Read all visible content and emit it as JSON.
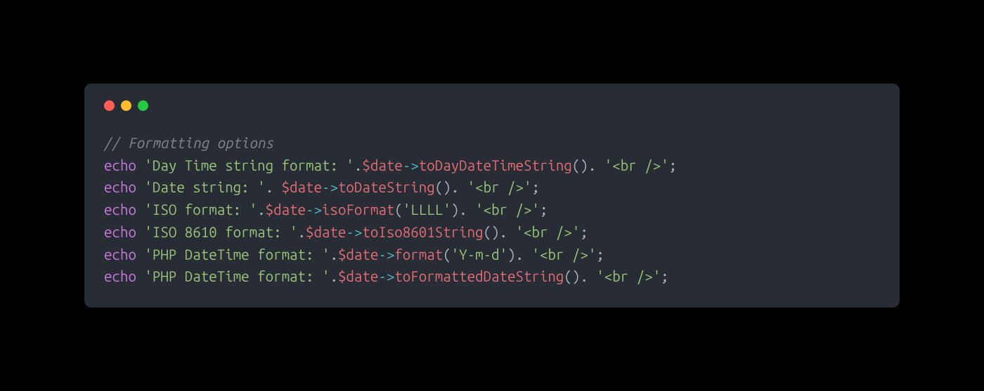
{
  "window": {
    "buttons": [
      "close",
      "minimize",
      "zoom"
    ]
  },
  "code": {
    "lines": [
      [
        {
          "cls": "tok-comment",
          "text": "// Formatting options"
        }
      ],
      [
        {
          "cls": "tok-keyword",
          "text": "echo"
        },
        {
          "cls": "tok-punct",
          "text": " "
        },
        {
          "cls": "tok-string",
          "text": "'Day Time string format: '"
        },
        {
          "cls": "tok-punct",
          "text": "."
        },
        {
          "cls": "tok-variable",
          "text": "$date"
        },
        {
          "cls": "tok-operator",
          "text": "->"
        },
        {
          "cls": "tok-method",
          "text": "toDayDateTimeString"
        },
        {
          "cls": "tok-punct",
          "text": "(). "
        },
        {
          "cls": "tok-string",
          "text": "'<br />'"
        },
        {
          "cls": "tok-punct",
          "text": ";"
        }
      ],
      [
        {
          "cls": "tok-keyword",
          "text": "echo"
        },
        {
          "cls": "tok-punct",
          "text": " "
        },
        {
          "cls": "tok-string",
          "text": "'Date string: '"
        },
        {
          "cls": "tok-punct",
          "text": ". "
        },
        {
          "cls": "tok-variable",
          "text": "$date"
        },
        {
          "cls": "tok-operator",
          "text": "->"
        },
        {
          "cls": "tok-method",
          "text": "toDateString"
        },
        {
          "cls": "tok-punct",
          "text": "(). "
        },
        {
          "cls": "tok-string",
          "text": "'<br />'"
        },
        {
          "cls": "tok-punct",
          "text": ";"
        }
      ],
      [
        {
          "cls": "tok-keyword",
          "text": "echo"
        },
        {
          "cls": "tok-punct",
          "text": " "
        },
        {
          "cls": "tok-string",
          "text": "'ISO format: '"
        },
        {
          "cls": "tok-punct",
          "text": "."
        },
        {
          "cls": "tok-variable",
          "text": "$date"
        },
        {
          "cls": "tok-operator",
          "text": "->"
        },
        {
          "cls": "tok-method",
          "text": "isoFormat"
        },
        {
          "cls": "tok-punct",
          "text": "("
        },
        {
          "cls": "tok-string",
          "text": "'LLLL'"
        },
        {
          "cls": "tok-punct",
          "text": "). "
        },
        {
          "cls": "tok-string",
          "text": "'<br />'"
        },
        {
          "cls": "tok-punct",
          "text": ";"
        }
      ],
      [
        {
          "cls": "tok-keyword",
          "text": "echo"
        },
        {
          "cls": "tok-punct",
          "text": " "
        },
        {
          "cls": "tok-string",
          "text": "'ISO 8610 format: '"
        },
        {
          "cls": "tok-punct",
          "text": "."
        },
        {
          "cls": "tok-variable",
          "text": "$date"
        },
        {
          "cls": "tok-operator",
          "text": "->"
        },
        {
          "cls": "tok-method",
          "text": "toIso8601String"
        },
        {
          "cls": "tok-punct",
          "text": "(). "
        },
        {
          "cls": "tok-string",
          "text": "'<br />'"
        },
        {
          "cls": "tok-punct",
          "text": ";"
        }
      ],
      [
        {
          "cls": "tok-keyword",
          "text": "echo"
        },
        {
          "cls": "tok-punct",
          "text": " "
        },
        {
          "cls": "tok-string",
          "text": "'PHP DateTime format: '"
        },
        {
          "cls": "tok-punct",
          "text": "."
        },
        {
          "cls": "tok-variable",
          "text": "$date"
        },
        {
          "cls": "tok-operator",
          "text": "->"
        },
        {
          "cls": "tok-method",
          "text": "format"
        },
        {
          "cls": "tok-punct",
          "text": "("
        },
        {
          "cls": "tok-string",
          "text": "'Y-m-d'"
        },
        {
          "cls": "tok-punct",
          "text": "). "
        },
        {
          "cls": "tok-string",
          "text": "'<br />'"
        },
        {
          "cls": "tok-punct",
          "text": ";"
        }
      ],
      [
        {
          "cls": "tok-keyword",
          "text": "echo"
        },
        {
          "cls": "tok-punct",
          "text": " "
        },
        {
          "cls": "tok-string",
          "text": "'PHP DateTime format: '"
        },
        {
          "cls": "tok-punct",
          "text": "."
        },
        {
          "cls": "tok-variable",
          "text": "$date"
        },
        {
          "cls": "tok-operator",
          "text": "->"
        },
        {
          "cls": "tok-method",
          "text": "toFormattedDateString"
        },
        {
          "cls": "tok-punct",
          "text": "(). "
        },
        {
          "cls": "tok-string",
          "text": "'<br />'"
        },
        {
          "cls": "tok-punct",
          "text": ";"
        }
      ]
    ]
  }
}
